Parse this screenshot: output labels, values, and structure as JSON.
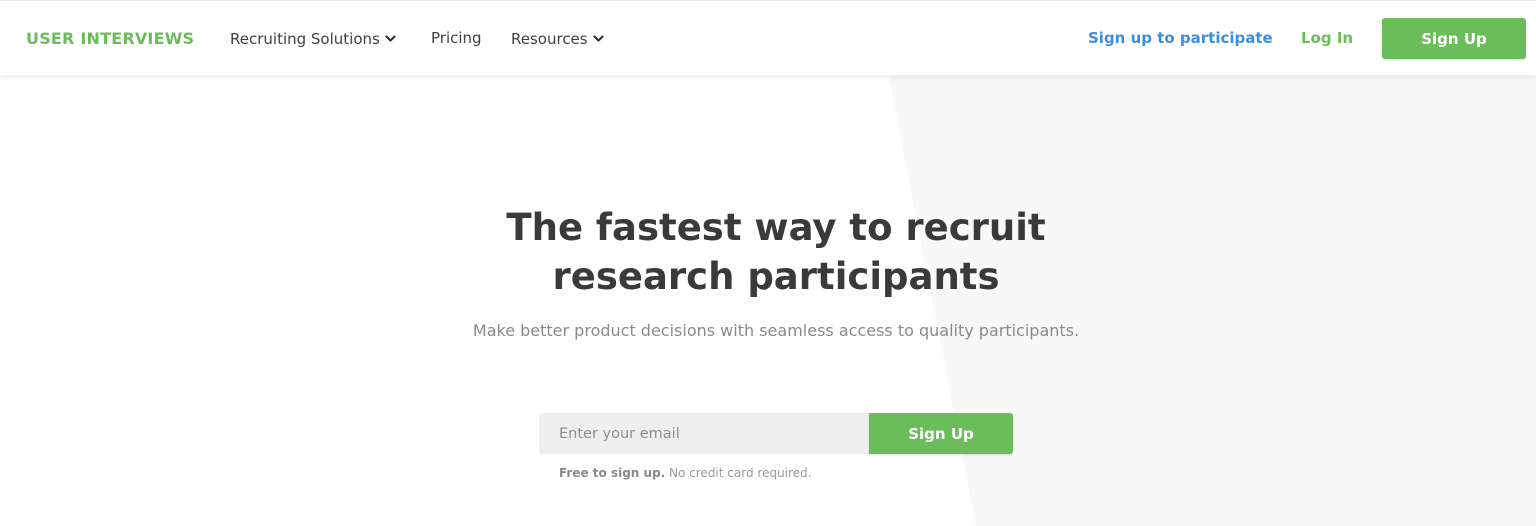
{
  "brand": {
    "logo_text": "USER INTERVIEWS",
    "accent_color": "#6bbd5b",
    "link_color": "#3b8fe0"
  },
  "nav": {
    "recruiting_label": "Recruiting Solutions",
    "pricing_label": "Pricing",
    "resources_label": "Resources",
    "participate_label": "Sign up to participate",
    "login_label": "Log In",
    "signup_label": "Sign Up",
    "dropdown_icon": "chevron-down-icon"
  },
  "hero": {
    "headline_line1": "The fastest way to recruit",
    "headline_line2": "research participants",
    "subheadline": "Make better product decisions with seamless access to quality participants.",
    "email_placeholder": "Enter your email",
    "signup_label": "Sign Up",
    "fineprint_bold": "Free to sign up.",
    "fineprint_rest": " No credit card required."
  }
}
